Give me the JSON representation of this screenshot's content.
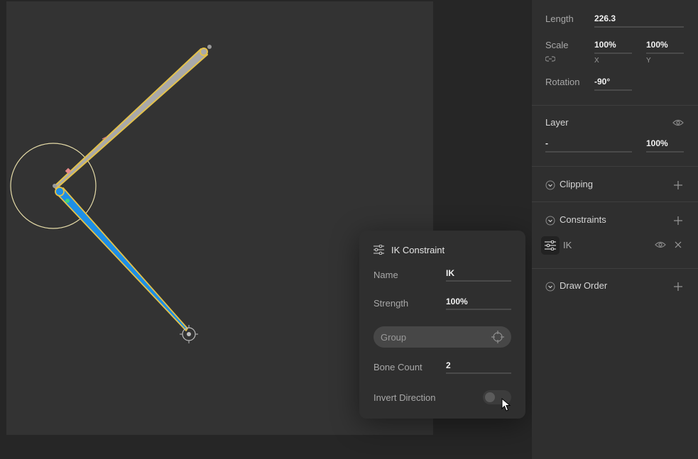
{
  "panel": {
    "length_label": "Length",
    "length_value": "226.3",
    "scale_label": "Scale",
    "scale_x": "100%",
    "scale_y": "100%",
    "scale_x_label": "X",
    "scale_y_label": "Y",
    "rotation_label": "Rotation",
    "rotation_value": "-90°",
    "layer_label": "Layer",
    "layer_name": "-",
    "layer_opacity": "100%",
    "clipping_label": "Clipping",
    "constraints_label": "Constraints",
    "constraint_item": "IK",
    "draw_order_label": "Draw Order"
  },
  "popup": {
    "title": "IK Constraint",
    "name_label": "Name",
    "name_value": "IK",
    "strength_label": "Strength",
    "strength_value": "100%",
    "group_placeholder": "Group",
    "bone_count_label": "Bone Count",
    "bone_count_value": "2",
    "invert_label": "Invert Direction",
    "invert_on": false
  },
  "colors": {
    "upper_bone": "#a9a9a9",
    "selection": "#e3c14a",
    "lower_bone": "#1e8fe6",
    "ik_circle": "#e6dca8"
  },
  "icons": [
    "sliders-icon",
    "eye-icon",
    "link-icon",
    "plus-icon",
    "close-icon",
    "chevron-down-icon",
    "crosshair-icon",
    "cursor-icon"
  ]
}
